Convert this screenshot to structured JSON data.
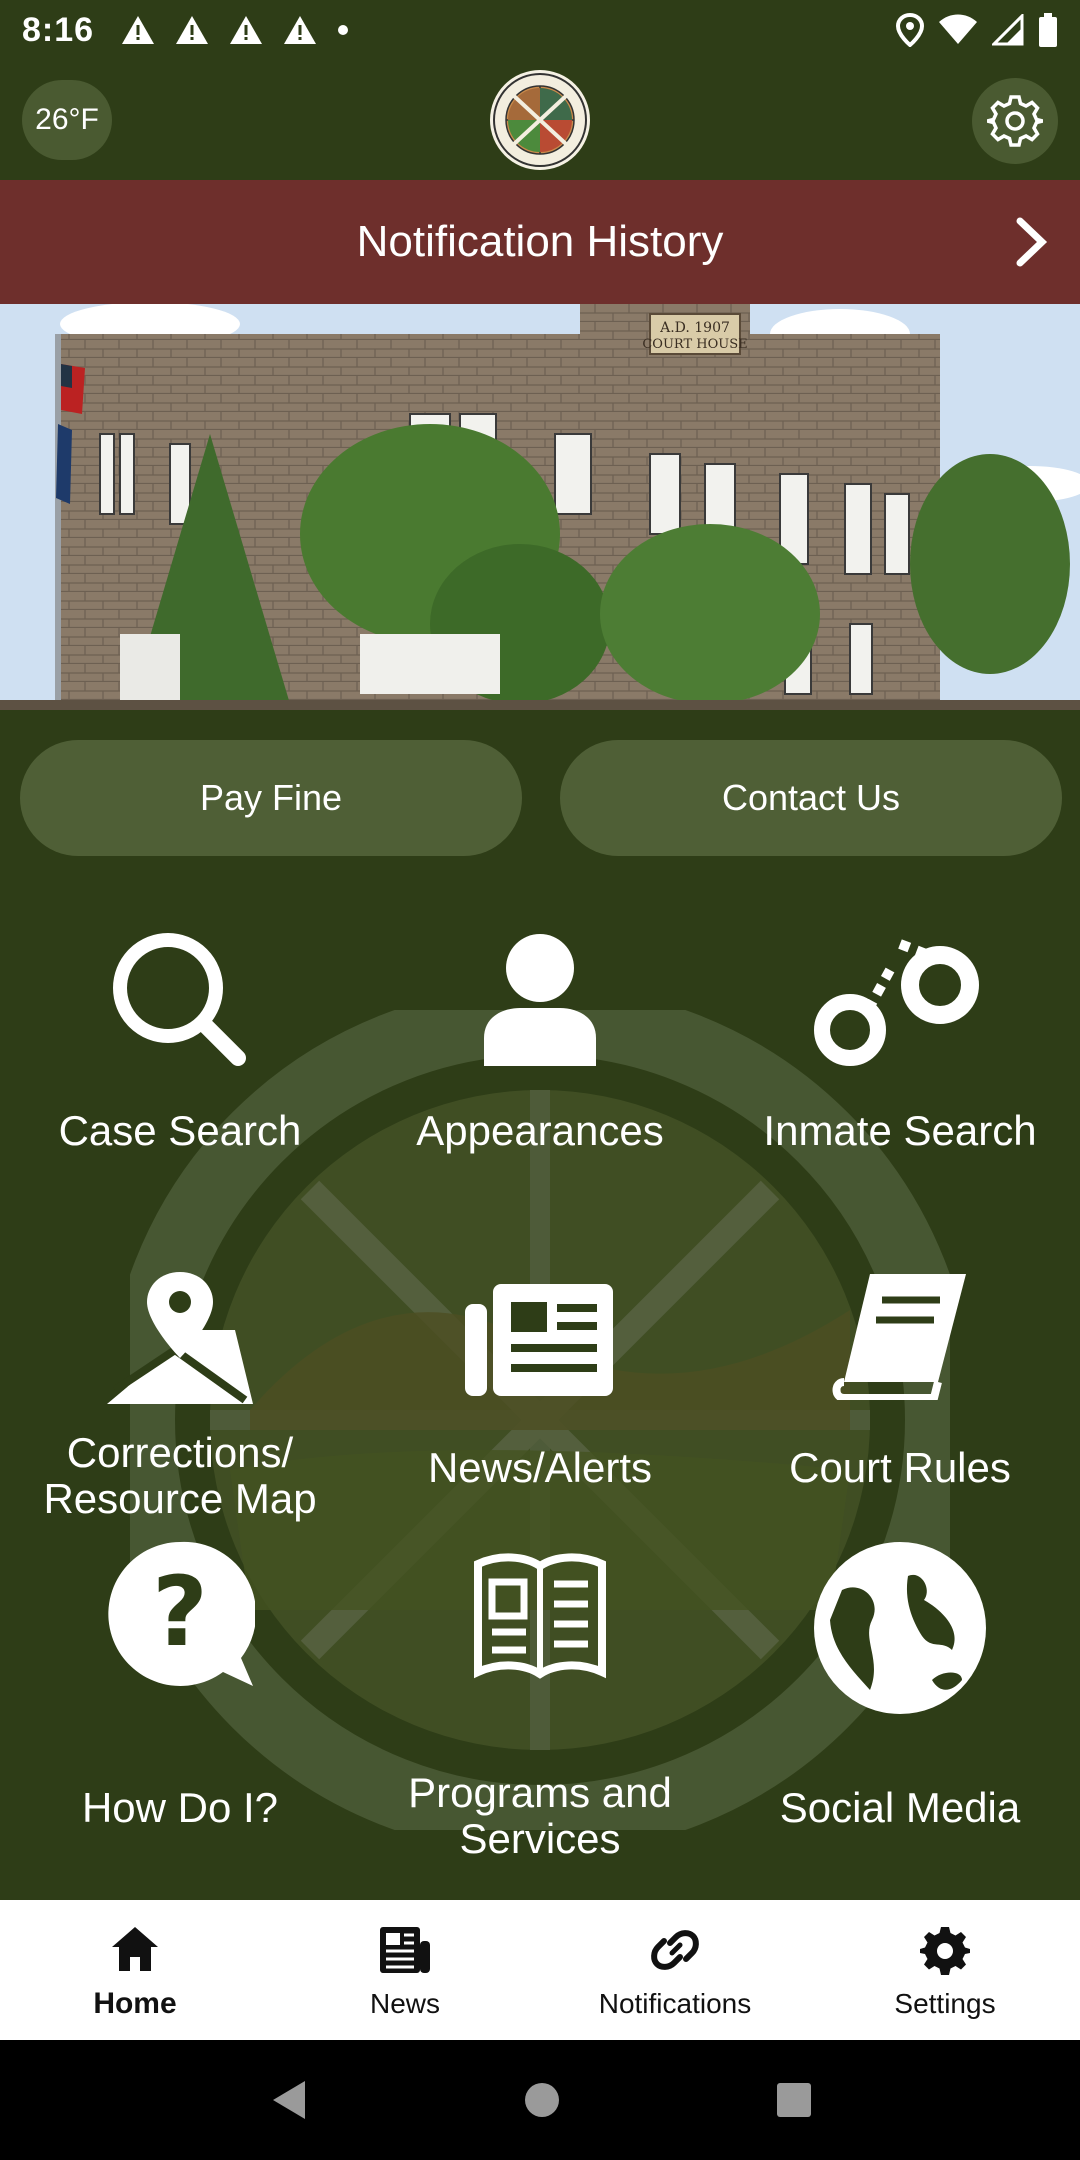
{
  "status_bar": {
    "time": "8:16",
    "left_icons": [
      "warning-icon",
      "warning-icon",
      "warning-icon",
      "warning-icon",
      "dot-icon"
    ],
    "right_icons": [
      "location-icon",
      "wifi-icon",
      "signal-icon",
      "battery-icon"
    ]
  },
  "header": {
    "temperature": "26°F",
    "logo": "esmeralda-county-seal",
    "settings_icon": "gear-icon"
  },
  "notification_bar": {
    "title": "Notification History",
    "chevron_icon": "chevron-right-icon"
  },
  "hero": {
    "image": "courthouse-photo",
    "sign_text": "A.D. 1907 COURT HOUSE"
  },
  "buttons": {
    "pay_fine": "Pay Fine",
    "contact_us": "Contact Us"
  },
  "grid": {
    "watermark": "county-seal-watermark",
    "items": [
      {
        "label": "Case Search",
        "icon": "search-icon"
      },
      {
        "label": "Appearances",
        "icon": "person-icon"
      },
      {
        "label": "Inmate Search",
        "icon": "handcuffs-icon"
      },
      {
        "label_line1": "Corrections/",
        "label_line2": "Resource Map",
        "icon": "map-icon"
      },
      {
        "label": "News/Alerts",
        "icon": "newspaper-icon"
      },
      {
        "label": "Court Rules",
        "icon": "book-icon"
      },
      {
        "label": "How Do I?",
        "icon": "question-icon"
      },
      {
        "label_line1": "Programs and",
        "label_line2": "Services",
        "icon": "open-book-icon"
      },
      {
        "label": "Social Media",
        "icon": "globe-icon"
      }
    ]
  },
  "bottom_nav": {
    "items": [
      {
        "label": "Home",
        "icon": "home-icon",
        "active": true
      },
      {
        "label": "News",
        "icon": "newspaper-icon",
        "active": false
      },
      {
        "label": "Notifications",
        "icon": "link-icon",
        "active": false
      },
      {
        "label": "Settings",
        "icon": "gear-icon",
        "active": false
      }
    ]
  },
  "system_nav": {
    "icons": [
      "back-icon",
      "home-circle-icon",
      "recents-icon"
    ]
  },
  "colors": {
    "background": "#2e3d17",
    "notification_bar": "#6e2f2c",
    "button": "#4f5f36",
    "text": "#ffffff"
  }
}
